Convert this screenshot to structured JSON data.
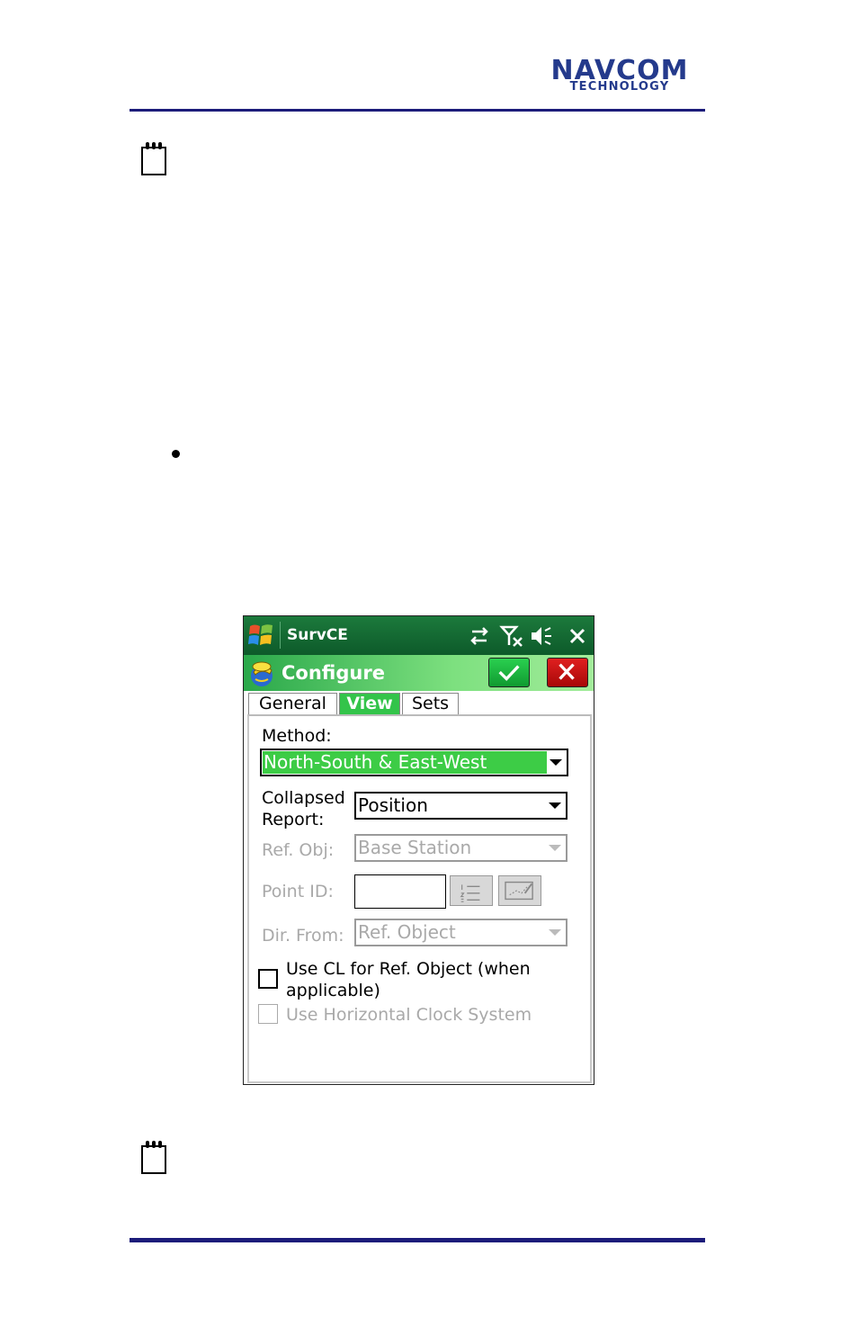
{
  "header": {
    "logo_line1": "NAVCOM",
    "logo_line2": "TECHNOLOGY"
  },
  "device": {
    "taskbar": {
      "app_name": "SurvCE"
    },
    "titlebar": {
      "title": "Configure"
    },
    "tabs": [
      {
        "label": "General",
        "active": false
      },
      {
        "label": "View",
        "active": true
      },
      {
        "label": "Sets",
        "active": false
      }
    ],
    "form": {
      "method_label": "Method:",
      "method_value": "North-South & East-West",
      "collapsed_label_1": "Collapsed",
      "collapsed_label_2": "Report:",
      "collapsed_value": "Position",
      "ref_obj_label": "Ref. Obj:",
      "ref_obj_value": "Base Station",
      "point_id_label": "Point ID:",
      "point_id_value": "",
      "dir_from_label": "Dir. From:",
      "dir_from_value": "Ref. Object",
      "use_cl_label_1": "Use CL for Ref. Object (when",
      "use_cl_label_2": "applicable)",
      "use_cl_checked": false,
      "use_clock_label": "Use Horizontal Clock System",
      "use_clock_checked": false
    }
  },
  "colors": {
    "rule": "#1c1c7a",
    "accent_green": "#33c44a",
    "logo_blue": "#243a8c"
  }
}
